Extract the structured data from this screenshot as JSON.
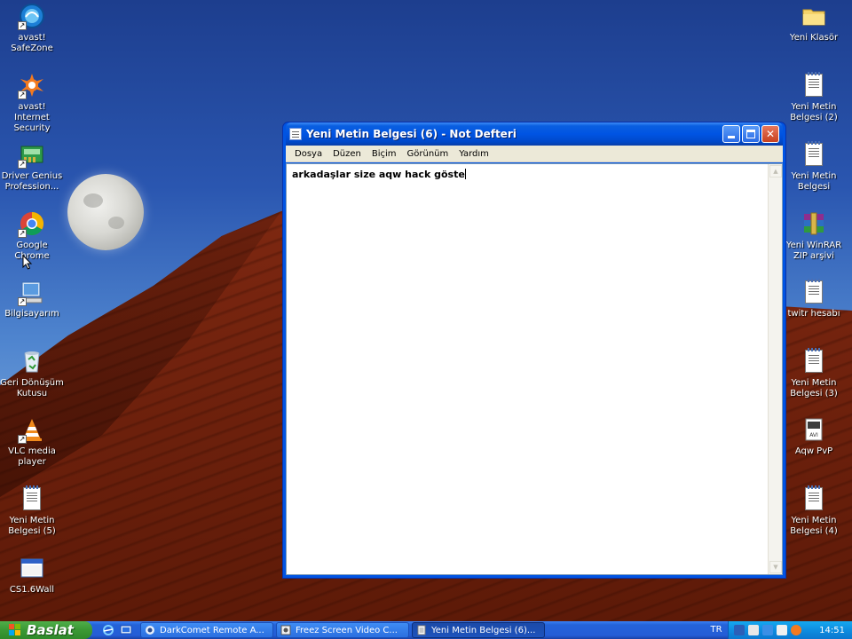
{
  "desktop": {
    "left_icons": [
      {
        "label": "avast!\nSafeZone",
        "icon": "avast-safezone-icon"
      },
      {
        "label": "avast! Internet\nSecurity",
        "icon": "avast-icon"
      },
      {
        "label": "Driver Genius\nProfession...",
        "icon": "driver-genius-icon"
      },
      {
        "label": "Google Chrome",
        "icon": "chrome-icon"
      },
      {
        "label": "Bilgisayarım",
        "icon": "computer-icon"
      },
      {
        "label": "Geri Dönüşüm\nKutusu",
        "icon": "recycle-bin-icon"
      },
      {
        "label": "VLC media\nplayer",
        "icon": "vlc-icon"
      },
      {
        "label": "Yeni Metin\nBelgesi (5)",
        "icon": "text-document-icon"
      },
      {
        "label": "CS1.6Wall",
        "icon": "window-app-icon"
      }
    ],
    "right_icons": [
      {
        "label": "Yeni Klasör",
        "icon": "folder-icon"
      },
      {
        "label": "Yeni Metin\nBelgesi (2)",
        "icon": "text-document-icon"
      },
      {
        "label": "Yeni Metin\nBelgesi",
        "icon": "text-document-icon"
      },
      {
        "label": "Yeni WinRAR\nZIP arşivi",
        "icon": "winrar-icon"
      },
      {
        "label": "twitr hesabı",
        "icon": "text-document-icon"
      },
      {
        "label": "Yeni Metin\nBelgesi (3)",
        "icon": "text-document-icon"
      },
      {
        "label": "Aqw PvP",
        "icon": "avi-file-icon"
      },
      {
        "label": "Yeni Metin\nBelgesi (4)",
        "icon": "text-document-icon"
      }
    ]
  },
  "notepad": {
    "title": "Yeni Metin Belgesi (6) - Not Defteri",
    "menu": [
      "Dosya",
      "Düzen",
      "Biçim",
      "Görünüm",
      "Yardım"
    ],
    "content": "arkadaşlar size aqw hack göste"
  },
  "taskbar": {
    "start_label": "Baslat",
    "tasks": [
      {
        "label": "DarkComet Remote A...",
        "active": false
      },
      {
        "label": "Freez Screen Video C...",
        "active": false
      },
      {
        "label": "Yeni Metin Belgesi (6)...",
        "active": true
      }
    ],
    "language": "TR",
    "clock": "14:51"
  },
  "colors": {
    "xp_blue": "#0054e3",
    "start_green": "#3c9a36",
    "tray_blue": "#0e8de0"
  }
}
